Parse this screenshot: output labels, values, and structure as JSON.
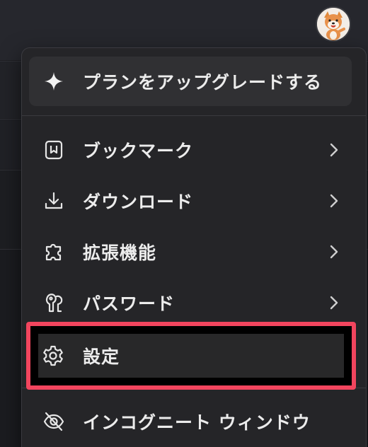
{
  "menu": {
    "upgrade_label": "プランをアップグレードする",
    "items": [
      {
        "label": "ブックマーク",
        "icon": "bookmark-icon",
        "has_submenu": true
      },
      {
        "label": "ダウンロード",
        "icon": "download-icon",
        "has_submenu": true
      },
      {
        "label": "拡張機能",
        "icon": "puzzle-icon",
        "has_submenu": true
      },
      {
        "label": "パスワード",
        "icon": "key-icon",
        "has_submenu": true
      },
      {
        "label": "設定",
        "icon": "gear-icon",
        "has_submenu": false,
        "highlighted": true
      },
      {
        "label": "インコグニート ウィンドウ",
        "icon": "incognito-icon",
        "has_submenu": false
      }
    ]
  },
  "colors": {
    "menu_bg": "#252528",
    "highlight_border": "#f2455e",
    "text": "#ececec"
  }
}
